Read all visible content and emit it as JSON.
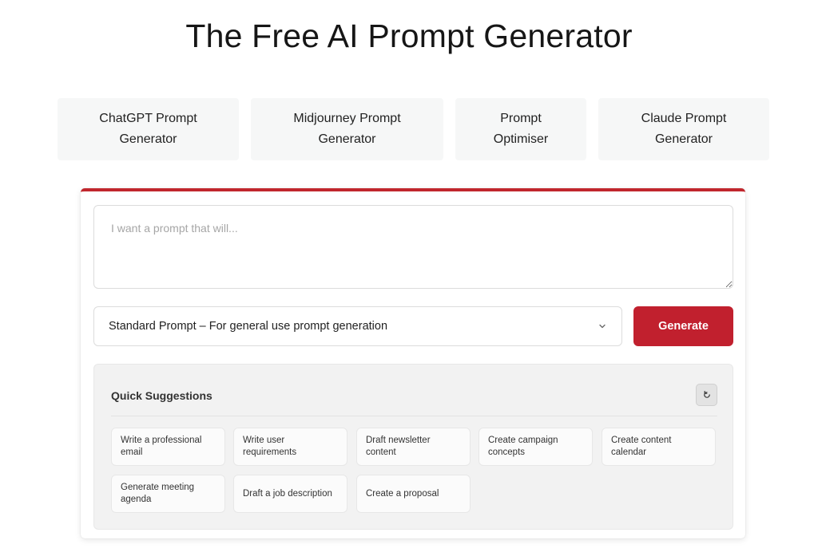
{
  "header": {
    "title": "The Free AI Prompt Generator"
  },
  "tool_tabs": [
    {
      "label": "ChatGPT Prompt Generator"
    },
    {
      "label": "Midjourney Prompt Generator"
    },
    {
      "label": "Prompt Optimiser"
    },
    {
      "label": "Claude Prompt Generator"
    }
  ],
  "form": {
    "prompt_placeholder": "I want a prompt that will...",
    "prompt_value": "",
    "prompt_type_selected": "Standard Prompt – For general use prompt generation",
    "generate_label": "Generate"
  },
  "suggestions": {
    "title": "Quick Suggestions",
    "refresh_icon": "refresh-icon",
    "items": [
      {
        "label": "Write a professional email"
      },
      {
        "label": "Write user requirements"
      },
      {
        "label": "Draft newsletter content"
      },
      {
        "label": "Create campaign concepts"
      },
      {
        "label": "Create content calendar"
      },
      {
        "label": "Generate meeting agenda"
      },
      {
        "label": "Draft a job description"
      },
      {
        "label": "Create a proposal"
      }
    ]
  },
  "colors": {
    "accent": "#c1202e",
    "tab_bg": "#f6f7f7",
    "panel_bg": "#f2f2f2"
  }
}
